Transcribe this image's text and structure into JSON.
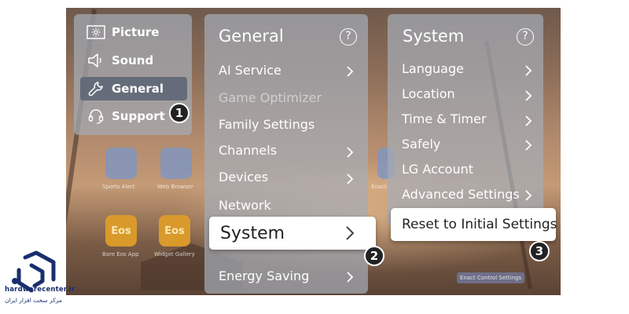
{
  "colors": {
    "panel": "#a5acb6",
    "highlight": "#ffffff",
    "step_badge": "#222222",
    "logo_blue": "#1a2e6e",
    "app_gold": "#d99a2b"
  },
  "background_apps": [
    {
      "label": "Sports Alert",
      "icon": "globe-icon"
    },
    {
      "label": "Web Browser",
      "icon": "globe-icon"
    },
    {
      "label": "Bare Eos App",
      "text": "Eos"
    },
    {
      "label": "Widget Gallery",
      "text": "Eos"
    },
    {
      "label": "Enact"
    },
    {
      "label": "Enact Control Settings"
    }
  ],
  "category_menu": [
    {
      "label": "Picture",
      "icon": "picture-settings-icon",
      "selected": false
    },
    {
      "label": "Sound",
      "icon": "speaker-icon",
      "selected": false
    },
    {
      "label": "General",
      "icon": "wrench-icon",
      "selected": true
    },
    {
      "label": "Support",
      "icon": "headset-icon",
      "selected": false
    }
  ],
  "general_panel": {
    "title": "General",
    "help": "?",
    "items": [
      {
        "label": "AI Service",
        "arrow": true,
        "disabled": false
      },
      {
        "label": "Game Optimizer",
        "arrow": false,
        "disabled": true
      },
      {
        "label": "Family Settings",
        "arrow": false,
        "disabled": false
      },
      {
        "label": "Channels",
        "arrow": true,
        "disabled": false
      },
      {
        "label": "Devices",
        "arrow": true,
        "disabled": false
      },
      {
        "label": "Network",
        "arrow": false,
        "disabled": false
      },
      {
        "label": "System",
        "arrow": true,
        "disabled": false,
        "highlighted": true
      },
      {
        "label": "Energy Saving",
        "arrow": true,
        "disabled": false
      }
    ]
  },
  "system_panel": {
    "title": "System",
    "help": "?",
    "items": [
      {
        "label": "Language",
        "arrow": true
      },
      {
        "label": "Location",
        "arrow": true
      },
      {
        "label": "Time & Timer",
        "arrow": true
      },
      {
        "label": "Safely",
        "arrow": true
      },
      {
        "label": "LG Account",
        "arrow": false
      },
      {
        "label": "Advanced Settings",
        "arrow": true
      },
      {
        "label": "Reset to Initial Settings",
        "arrow": false,
        "highlighted": true
      }
    ]
  },
  "steps": [
    "1",
    "2",
    "3"
  ],
  "watermark": {
    "site": "hardwarecenter.ir",
    "tagline": "مرکز سخت افزار ایران"
  }
}
